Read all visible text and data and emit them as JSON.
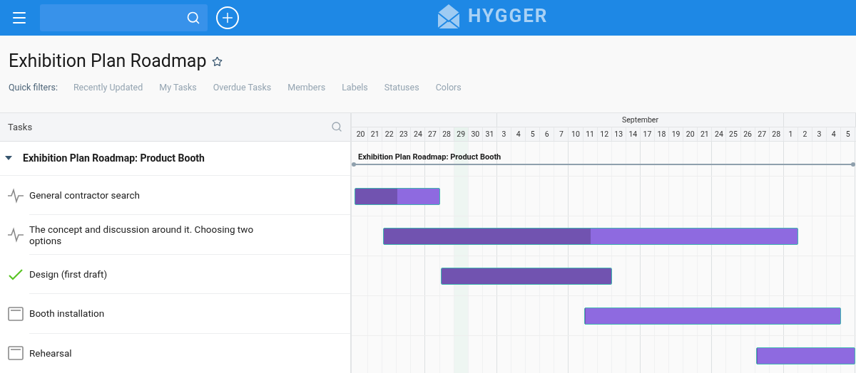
{
  "top_bar": {
    "logo": "HYGGER"
  },
  "page": {
    "title": "Exhibition Plan Roadmap",
    "starred": false
  },
  "quick_filters": {
    "label": "Quick filters:",
    "items": [
      "Recently Updated",
      "My Tasks",
      "Overdue Tasks",
      "Members",
      "Labels",
      "Statuses",
      "Colors"
    ]
  },
  "tasks_panel": {
    "header": "Tasks",
    "group": {
      "title": "Exhibition Plan Roadmap: Product Booth",
      "expanded": true,
      "children": [
        {
          "title": "General contractor search",
          "kind": "in_progress",
          "level": 0.5
        },
        {
          "title": "The concept and discussion around it. Choosing two options",
          "kind": "in_progress",
          "level": 0.5
        },
        {
          "title": "Design (first draft)",
          "kind": "done",
          "level": 1
        },
        {
          "title": "Booth installation",
          "kind": "todo",
          "level": 0
        },
        {
          "title": "Rehearsal",
          "kind": "todo",
          "level": 0
        }
      ]
    }
  },
  "timeline": {
    "months": [
      {
        "days": [
          {
            "label": "20",
            "today": false
          },
          {
            "label": "21",
            "today": false
          },
          {
            "label": "22",
            "today": false
          },
          {
            "label": "23",
            "today": false
          },
          {
            "label": "24",
            "today": false
          },
          {
            "label": "27",
            "today": false
          },
          {
            "label": "28",
            "today": false
          },
          {
            "label": "29",
            "today": true
          },
          {
            "label": "30",
            "today": false
          },
          {
            "label": "31",
            "today": false
          }
        ]
      },
      {
        "label": "September",
        "days": [
          {
            "label": "3",
            "today": false
          },
          {
            "label": "4",
            "today": false
          },
          {
            "label": "5",
            "today": false
          },
          {
            "label": "6",
            "today": false
          },
          {
            "label": "7",
            "today": false
          },
          {
            "label": "10",
            "today": false
          },
          {
            "label": "11",
            "today": false
          },
          {
            "label": "12",
            "today": false
          },
          {
            "label": "13",
            "today": false
          },
          {
            "label": "14",
            "today": false
          },
          {
            "label": "17",
            "today": false
          },
          {
            "label": "18",
            "today": false
          },
          {
            "label": "19",
            "today": false
          },
          {
            "label": "20",
            "today": false
          },
          {
            "label": "21",
            "today": false
          },
          {
            "label": "24",
            "today": false
          },
          {
            "label": "25",
            "today": false
          },
          {
            "label": "26",
            "today": false
          },
          {
            "label": "27",
            "today": false
          },
          {
            "label": "28",
            "today": false
          }
        ]
      },
      {
        "days": [
          {
            "label": "1",
            "today": false
          },
          {
            "label": "2",
            "today": false
          },
          {
            "label": "3",
            "today": false
          },
          {
            "label": "4",
            "today": false
          },
          {
            "label": "5",
            "today": false
          }
        ]
      }
    ],
    "group_label": "Exhibition Plan Roadmap: Product Booth"
  }
}
